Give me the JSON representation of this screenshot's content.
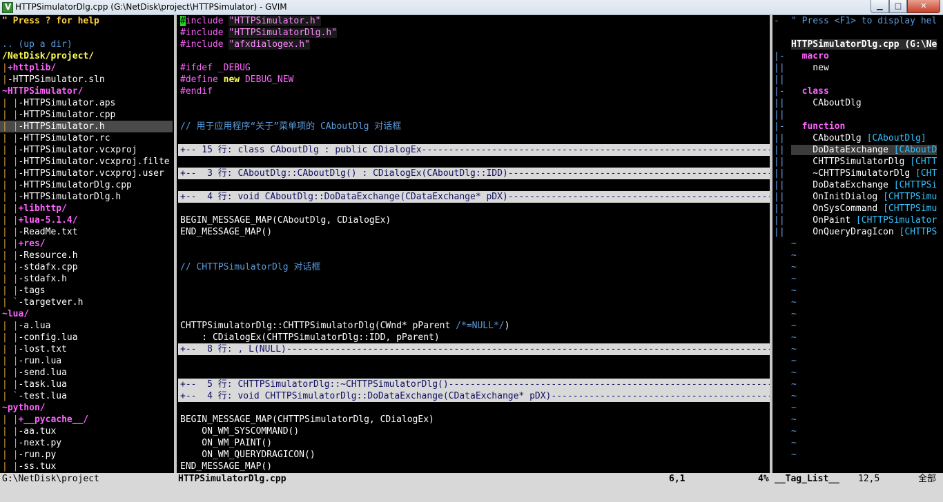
{
  "window": {
    "title": "HTTPSimulatorDlg.cpp (G:\\NetDisk\\project\\HTTPSimulator) - GVIM",
    "min_label": "▁",
    "max_label": "□",
    "close_label": "✕"
  },
  "tree": {
    "lines": [
      [
        [
          "\" Press ? for help",
          "c-help"
        ]
      ],
      [
        [
          "",
          ""
        ]
      ],
      [
        [
          ".. (up a dir)",
          "c-comment"
        ]
      ],
      [
        [
          "/NetDisk/project/",
          "c-root"
        ]
      ],
      [
        [
          "|",
          "c-bar"
        ],
        [
          "+httplib/",
          "c-dir"
        ]
      ],
      [
        [
          "|",
          "c-bar"
        ],
        [
          "-HTTPSimulator.sln",
          "c-file"
        ]
      ],
      [
        [
          "~HTTPSimulator/",
          "c-dir"
        ]
      ],
      [
        [
          "| |",
          "c-bar"
        ],
        [
          "-HTTPSimulator.aps",
          "c-file"
        ]
      ],
      [
        [
          "| |",
          "c-bar"
        ],
        [
          "-HTTPSimulator.cpp",
          "c-file"
        ]
      ],
      [
        [
          "| |",
          "c-bar"
        ],
        [
          "-HTTPSimulator.h",
          "c-file"
        ]
      ],
      [
        [
          "| |",
          "c-bar"
        ],
        [
          "-HTTPSimulator.rc",
          "c-file"
        ]
      ],
      [
        [
          "| |",
          "c-bar"
        ],
        [
          "-HTTPSimulator.vcxproj",
          "c-file"
        ]
      ],
      [
        [
          "| |",
          "c-bar"
        ],
        [
          "-HTTPSimulator.vcxproj.filte",
          "c-file"
        ]
      ],
      [
        [
          "| |",
          "c-bar"
        ],
        [
          "-HTTPSimulator.vcxproj.user",
          "c-file"
        ]
      ],
      [
        [
          "| |",
          "c-bar"
        ],
        [
          "-HTTPSimulatorDlg.cpp",
          "c-file"
        ]
      ],
      [
        [
          "| |",
          "c-bar"
        ],
        [
          "-HTTPSimulatorDlg.h",
          "c-file"
        ]
      ],
      [
        [
          "| |",
          "c-bar"
        ],
        [
          "+libhttp/",
          "c-dir"
        ]
      ],
      [
        [
          "| |",
          "c-bar"
        ],
        [
          "+lua-5.1.4/",
          "c-dir"
        ]
      ],
      [
        [
          "| |",
          "c-bar"
        ],
        [
          "-ReadMe.txt",
          "c-file"
        ]
      ],
      [
        [
          "| |",
          "c-bar"
        ],
        [
          "+res/",
          "c-dir"
        ]
      ],
      [
        [
          "| |",
          "c-bar"
        ],
        [
          "-Resource.h",
          "c-file"
        ]
      ],
      [
        [
          "| |",
          "c-bar"
        ],
        [
          "-stdafx.cpp",
          "c-file"
        ]
      ],
      [
        [
          "| |",
          "c-bar"
        ],
        [
          "-stdafx.h",
          "c-file"
        ]
      ],
      [
        [
          "| |",
          "c-bar"
        ],
        [
          "-tags",
          "c-file"
        ]
      ],
      [
        [
          "| `",
          "c-bar"
        ],
        [
          "-targetver.h",
          "c-file"
        ]
      ],
      [
        [
          "~lua/",
          "c-dir"
        ]
      ],
      [
        [
          "| |",
          "c-bar"
        ],
        [
          "-a.lua",
          "c-file"
        ]
      ],
      [
        [
          "| |",
          "c-bar"
        ],
        [
          "-config.lua",
          "c-file"
        ]
      ],
      [
        [
          "| |",
          "c-bar"
        ],
        [
          "-lost.txt",
          "c-file"
        ]
      ],
      [
        [
          "| |",
          "c-bar"
        ],
        [
          "-run.lua",
          "c-file"
        ]
      ],
      [
        [
          "| |",
          "c-bar"
        ],
        [
          "-send.lua",
          "c-file"
        ]
      ],
      [
        [
          "| |",
          "c-bar"
        ],
        [
          "-task.lua",
          "c-file"
        ]
      ],
      [
        [
          "| `",
          "c-bar"
        ],
        [
          "-test.lua",
          "c-file"
        ]
      ],
      [
        [
          "~python/",
          "c-dir"
        ]
      ],
      [
        [
          "| |",
          "c-bar"
        ],
        [
          "+__pycache__/",
          "c-dir"
        ]
      ],
      [
        [
          "| |",
          "c-bar"
        ],
        [
          "-aa.tux",
          "c-file"
        ]
      ],
      [
        [
          "| |",
          "c-bar"
        ],
        [
          "-next.py",
          "c-file"
        ]
      ],
      [
        [
          "| |",
          "c-bar"
        ],
        [
          "-run.py",
          "c-file"
        ]
      ],
      [
        [
          "| |",
          "c-bar"
        ],
        [
          "-ss.tux",
          "c-file"
        ]
      ]
    ],
    "selected_index": 9
  },
  "code": {
    "lines": [
      {
        "segs": [
          [
            "#",
            "cursorcell"
          ],
          [
            "include ",
            "c-pre"
          ],
          [
            "\"HTTPSimulator.h\"",
            "c-str hl-str"
          ]
        ]
      },
      {
        "segs": [
          [
            "#include ",
            "c-pre"
          ],
          [
            "\"HTTPSimulatorDlg.h\"",
            "c-str hl-str"
          ]
        ]
      },
      {
        "segs": [
          [
            "#include ",
            "c-pre"
          ],
          [
            "\"afxdialogex.h\"",
            "c-str hl-str"
          ]
        ]
      },
      {
        "segs": [
          [
            "",
            ""
          ]
        ]
      },
      {
        "segs": [
          [
            "#ifdef _DEBUG",
            "c-pre"
          ]
        ]
      },
      {
        "segs": [
          [
            "#define ",
            "c-pre"
          ],
          [
            "new ",
            "c-kw"
          ],
          [
            "DEBUG_NEW",
            "c-pre"
          ]
        ]
      },
      {
        "segs": [
          [
            "#endif",
            "c-pre"
          ]
        ]
      },
      {
        "segs": [
          [
            "",
            ""
          ]
        ]
      },
      {
        "segs": [
          [
            "",
            ""
          ]
        ]
      },
      {
        "segs": [
          [
            "// 用于应用程序“关于”菜单项的 CAboutDlg 对话框",
            "c-cm"
          ]
        ]
      },
      {
        "segs": [
          [
            "",
            ""
          ]
        ]
      },
      {
        "fold": true,
        "segs": [
          [
            "+-- 15 行: class CAboutDlg : public CDialogEx----------------------------------------------------------------------------",
            "fold"
          ]
        ]
      },
      {
        "segs": [
          [
            "",
            ""
          ]
        ]
      },
      {
        "fold": true,
        "segs": [
          [
            "+--  3 行: CAboutDlg::CAboutDlg() : CDialogEx(CAboutDlg::IDD)-----------------------------------------------------------",
            "fold"
          ]
        ]
      },
      {
        "segs": [
          [
            "",
            ""
          ]
        ]
      },
      {
        "fold": true,
        "segs": [
          [
            "+--  4 行: void CAboutDlg::DoDataExchange(CDataExchange* pDX)------------------------------------------------------------",
            "fold"
          ]
        ]
      },
      {
        "segs": [
          [
            "",
            ""
          ]
        ]
      },
      {
        "segs": [
          [
            "BEGIN_MESSAGE_MAP(CAboutDlg, CDialogEx)",
            "c-file"
          ]
        ]
      },
      {
        "segs": [
          [
            "END_MESSAGE_MAP()",
            "c-file"
          ]
        ]
      },
      {
        "segs": [
          [
            "",
            ""
          ]
        ]
      },
      {
        "segs": [
          [
            "",
            ""
          ]
        ]
      },
      {
        "segs": [
          [
            "// CHTTPSimulatorDlg 对话框",
            "c-cm"
          ]
        ]
      },
      {
        "segs": [
          [
            "",
            ""
          ]
        ]
      },
      {
        "segs": [
          [
            "",
            ""
          ]
        ]
      },
      {
        "segs": [
          [
            "",
            ""
          ]
        ]
      },
      {
        "segs": [
          [
            "",
            ""
          ]
        ]
      },
      {
        "segs": [
          [
            "CHTTPSimulatorDlg::CHTTPSimulatorDlg(CWnd* pParent ",
            "c-file"
          ],
          [
            "/*=NULL*/",
            "c-cm"
          ],
          [
            ")",
            "c-file"
          ]
        ]
      },
      {
        "segs": [
          [
            "    : CDialogEx(CHTTPSimulatorDlg::IDD, pParent)",
            "c-file"
          ]
        ]
      },
      {
        "fold": true,
        "segs": [
          [
            "+--  8 行: , L(NULL)---------------------------------------------------------------------------------------------------",
            "fold"
          ]
        ]
      },
      {
        "segs": [
          [
            "",
            ""
          ]
        ]
      },
      {
        "segs": [
          [
            "",
            ""
          ]
        ]
      },
      {
        "fold": true,
        "segs": [
          [
            "+--  5 行: CHTTPSimulatorDlg::~CHTTPSimulatorDlg()----------------------------------------------------------------------",
            "fold"
          ]
        ]
      },
      {
        "fold": true,
        "segs": [
          [
            "+--  4 行: void CHTTPSimulatorDlg::DoDataExchange(CDataExchange* pDX)----------------------------------------------------",
            "fold"
          ]
        ]
      },
      {
        "segs": [
          [
            "",
            ""
          ]
        ]
      },
      {
        "segs": [
          [
            "BEGIN_MESSAGE_MAP(CHTTPSimulatorDlg, CDialogEx)",
            "c-file"
          ]
        ]
      },
      {
        "segs": [
          [
            "    ON_WM_SYSCOMMAND()",
            "c-file"
          ]
        ]
      },
      {
        "segs": [
          [
            "    ON_WM_PAINT()",
            "c-file"
          ]
        ]
      },
      {
        "segs": [
          [
            "    ON_WM_QUERYDRAGICON()",
            "c-file"
          ]
        ]
      },
      {
        "segs": [
          [
            "END_MESSAGE_MAP()",
            "c-file"
          ]
        ]
      }
    ]
  },
  "tagfold": [
    "-",
    "",
    "",
    "|-",
    "||",
    "||",
    "|-",
    "||",
    "||",
    "|-",
    "||",
    "||",
    "||",
    "||",
    "||",
    "||",
    "||",
    "||",
    "||"
  ],
  "taglist": {
    "lines": [
      [
        [
          "\" Press <F1> to display hel",
          "c-comment"
        ]
      ],
      [
        [
          "",
          ""
        ]
      ],
      [
        [
          "HTTPSimulatorDlg.cpp (G:\\Ne",
          "c-tagtitle"
        ]
      ],
      [
        [
          "  macro",
          "c-tagkind"
        ]
      ],
      [
        [
          "    new",
          "c-file"
        ]
      ],
      [
        [
          "",
          ""
        ]
      ],
      [
        [
          "  class",
          "c-tagkind"
        ]
      ],
      [
        [
          "    CAboutDlg",
          "c-file"
        ]
      ],
      [
        [
          "",
          ""
        ]
      ],
      [
        [
          "  function",
          "c-tagkind"
        ]
      ],
      [
        [
          "    CAboutDlg ",
          "c-file"
        ],
        [
          "[CAboutDlg]",
          "c-tagscope"
        ]
      ],
      [
        [
          "    DoDataExchange ",
          "c-file"
        ],
        [
          "[CAboutD",
          "c-tagscope"
        ]
      ],
      [
        [
          "    CHTTPSimulatorDlg ",
          "c-file"
        ],
        [
          "[CHTT",
          "c-tagscope"
        ]
      ],
      [
        [
          "    ~CHTTPSimulatorDlg ",
          "c-file"
        ],
        [
          "[CHT",
          "c-tagscope"
        ]
      ],
      [
        [
          "    DoDataExchange ",
          "c-file"
        ],
        [
          "[CHTTPSi",
          "c-tagscope"
        ]
      ],
      [
        [
          "    OnInitDialog ",
          "c-file"
        ],
        [
          "[CHTTPSimu",
          "c-tagscope"
        ]
      ],
      [
        [
          "    OnSysCommand ",
          "c-file"
        ],
        [
          "[CHTTPSimu",
          "c-tagscope"
        ]
      ],
      [
        [
          "    OnPaint ",
          "c-file"
        ],
        [
          "[CHTTPSimulator",
          "c-tagscope"
        ]
      ],
      [
        [
          "    OnQueryDragIcon ",
          "c-file"
        ],
        [
          "[CHTTPS",
          "c-tagscope"
        ]
      ]
    ],
    "selected_index": 11,
    "tilde": "~",
    "tilde_count": 19
  },
  "status": {
    "tree": "G:\\NetDisk\\project",
    "file": "HTTPSimulatorDlg.cpp",
    "pos": "6,1",
    "pct": "4%",
    "tag": "__Tag_List__",
    "tagpos": "12,5",
    "all": "全部"
  }
}
